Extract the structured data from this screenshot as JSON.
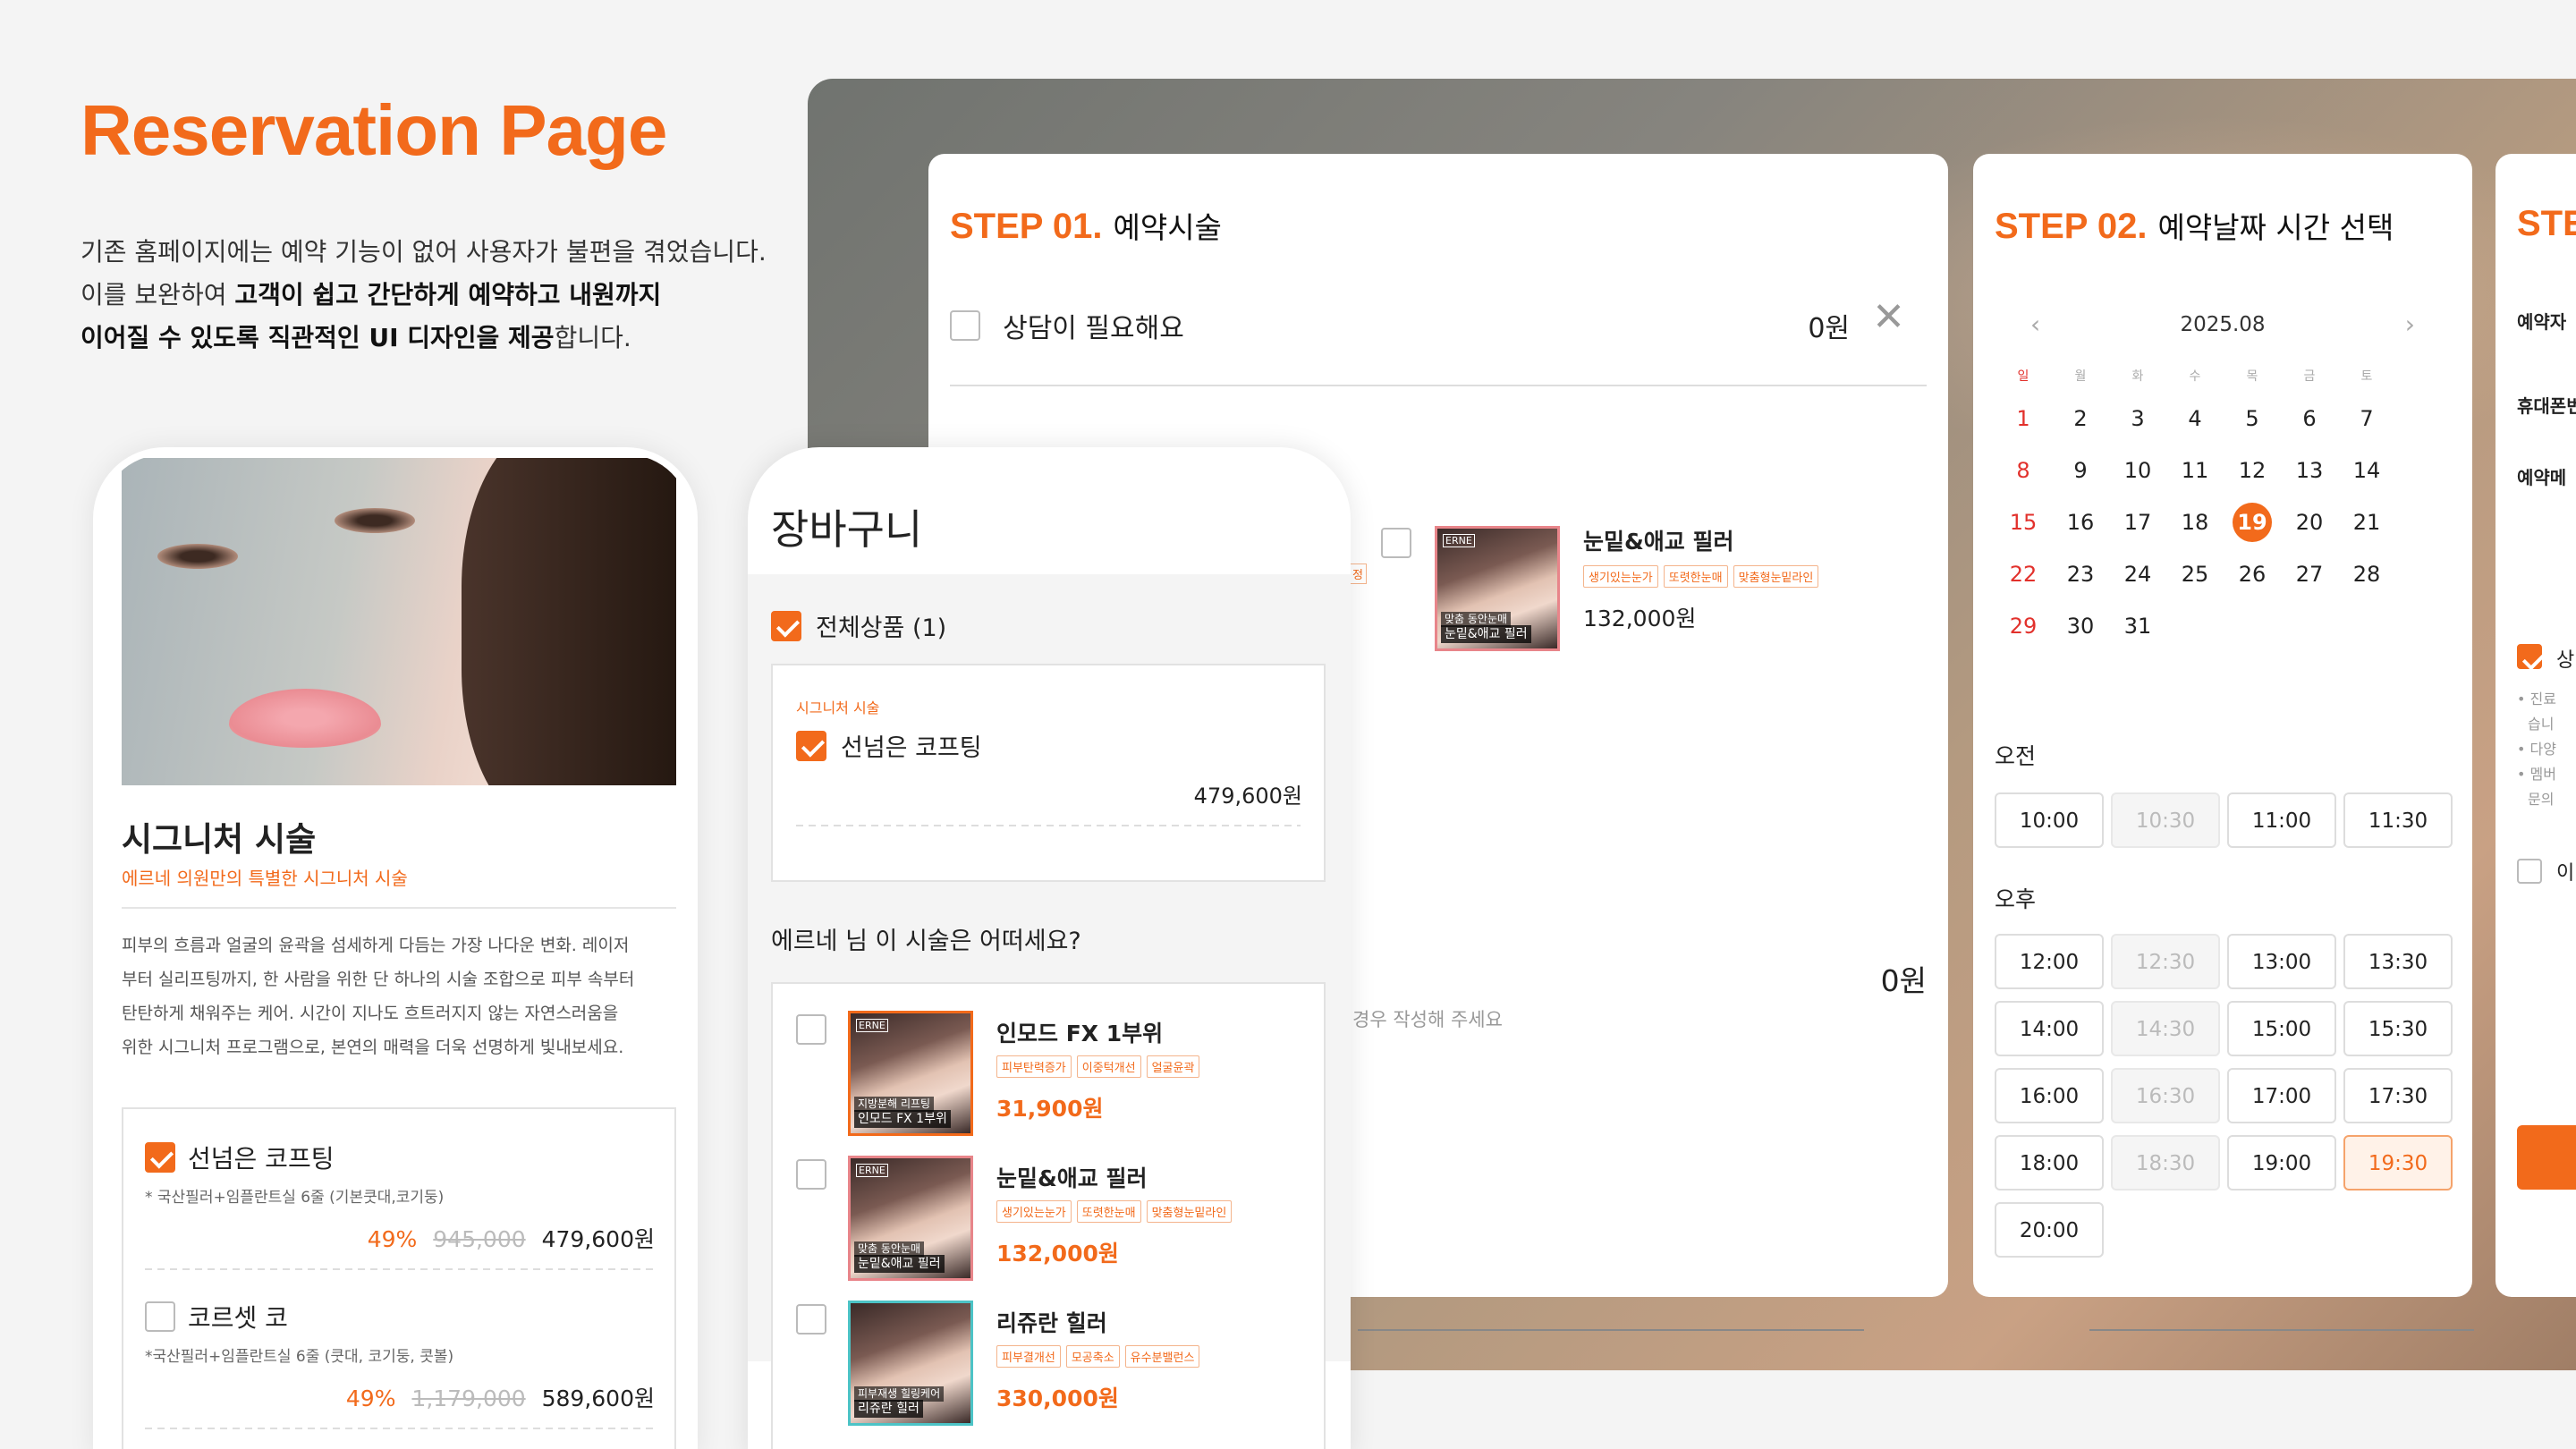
{
  "hero": {
    "title": "Reservation Page",
    "line1": "기존 홈페이지에는 예약 기능이 없어 사용자가 불편을 겪었습니다.",
    "line2_pre": "이를 보완하여 ",
    "line2_bold": "고객이 쉽고 간단하게 예약하고 내원까지",
    "line3_bold": "이어질 수 있도록 직관적인 UI 디자인을 제공",
    "line3_post": "합니다."
  },
  "step1": {
    "num": "STEP 01.",
    "title": "예약시술",
    "consult_label": "상담이 필요해요",
    "consult_price": "0원",
    "item": {
      "name": "눈밑&애교 필러",
      "tags": [
        "생기있는눈가",
        "또렷한눈매",
        "맞춤형눈밑라인"
      ],
      "price": "132,000원",
      "cap1": "맞춤 동안눈매",
      "cap2": "눈밑&애교 필러",
      "logo": "ERNE"
    },
    "total": "0원",
    "memo_hint": "경우 작성해 주세요",
    "left_tag": "정"
  },
  "step2": {
    "num": "STEP 02.",
    "title": "예약날짜 시간 선택",
    "month": "2025.08",
    "dow": [
      "일",
      "월",
      "화",
      "수",
      "목",
      "금",
      "토"
    ],
    "weeks": [
      [
        "",
        "1",
        "2",
        "3",
        "4",
        "5",
        "6",
        "7"
      ],
      [
        "8",
        "9",
        "10",
        "11",
        "12",
        "13",
        "14"
      ],
      [
        "15",
        "16",
        "17",
        "18",
        "19",
        "20",
        "21"
      ],
      [
        "22",
        "23",
        "24",
        "25",
        "26",
        "27",
        "28"
      ],
      [
        "29",
        "30",
        "31"
      ]
    ],
    "selected_day": "19",
    "am_label": "오전",
    "pm_label": "오후",
    "am_slots": [
      "10:00",
      "10:30",
      "11:00",
      "11:30"
    ],
    "pm_slots": [
      "12:00",
      "12:30",
      "13:00",
      "13:30",
      "14:00",
      "14:30",
      "15:00",
      "15:30",
      "16:00",
      "16:30",
      "17:00",
      "17:30",
      "18:00",
      "18:30",
      "19:00",
      "19:30",
      "20:00"
    ],
    "disabled_slots": [
      "10:30",
      "12:30",
      "14:30",
      "16:30",
      "18:30"
    ],
    "active_slot": "19:30"
  },
  "step3": {
    "num": "STE",
    "f1": "예약자",
    "f2": "휴대폰번",
    "f3": "예약메",
    "chk1": "상",
    "n1": "• 진료",
    "n1b": "습니",
    "n2": "• 다양",
    "n3": "• 멤버",
    "n3b": "문의",
    "chk2": "이"
  },
  "phone1": {
    "title": "시그니처 시술",
    "subtitle": "에르네 의원만의 특별한 시그니처 시술",
    "desc1": "피부의 흐름과 얼굴의 윤곽을 섬세하게 다듬는 가장 나다운 변화. 레이저",
    "desc2": "부터 실리프팅까지, 한 사람을 위한 단 하나의 시술 조합으로 피부 속부터",
    "desc3": "탄탄하게 채워주는 케어. 시간이 지나도 흐트러지지 않는 자연스러움을",
    "desc4": "위한 시그니처 프로그램으로, 본연의 매력을 더욱 선명하게 빛내보세요.",
    "opt1": {
      "name": "선넘은 코프팅",
      "detail": "* 국산필러+임플란트실 6줄 (기본쿳대,코기둥)",
      "discount": "49%",
      "old": "945,000",
      "price": "479,600원"
    },
    "opt2": {
      "name": "코르셋 코",
      "detail": "*국산필러+임플란트실 6줄 (쿳대, 코기둥, 콧볼)",
      "discount": "49%",
      "old": "1,179,000",
      "price": "589,600원"
    }
  },
  "phone2": {
    "title": "장바구니",
    "all_label": "전체상품 (1)",
    "cart_cat": "시그니처 시술",
    "cart_item": "선넘은 코프팅",
    "cart_price": "479,600원",
    "reco_title": "에르네 님 이 시술은 어떠세요?",
    "reco": [
      {
        "name": "인모드 FX 1부위",
        "tags": [
          "피부탄력증가",
          "이중턱개선",
          "얼굴윤곽"
        ],
        "price": "31,900원",
        "cap1": "지방분해 리프팅",
        "cap2": "인모드 FX 1부위",
        "logo": "ERNE"
      },
      {
        "name": "눈밑&애교 필러",
        "tags": [
          "생기있는눈가",
          "또렷한눈매",
          "맞춤형눈밑라인"
        ],
        "price": "132,000원",
        "cap1": "맞춤 동안눈매",
        "cap2": "눈밑&애교 필러",
        "logo": "ERNE"
      },
      {
        "name": "리쥬란 힐러",
        "tags": [
          "피부결개선",
          "모공축소",
          "유수분밸런스"
        ],
        "price": "330,000원",
        "cap1": "피부재생 힐링케어",
        "cap2": "리쥬란 힐러",
        "logo": ""
      }
    ]
  },
  "colors": {
    "accent": "#f26a1b",
    "sunday": "#e2312c"
  }
}
